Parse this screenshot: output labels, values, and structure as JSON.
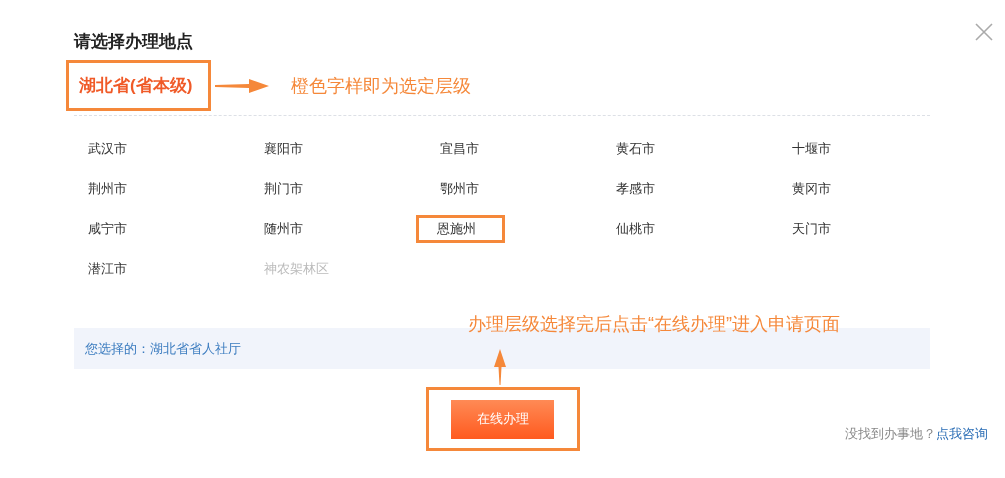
{
  "dialog": {
    "title": "请选择办理地点",
    "province": {
      "label": "湖北省(省本级)",
      "highlighted": true
    },
    "cities": [
      {
        "name": "武汉市",
        "disabled": false,
        "highlighted": false
      },
      {
        "name": "襄阳市",
        "disabled": false,
        "highlighted": false
      },
      {
        "name": "宜昌市",
        "disabled": false,
        "highlighted": false
      },
      {
        "name": "黄石市",
        "disabled": false,
        "highlighted": false
      },
      {
        "name": "十堰市",
        "disabled": false,
        "highlighted": false
      },
      {
        "name": "荆州市",
        "disabled": false,
        "highlighted": false
      },
      {
        "name": "荆门市",
        "disabled": false,
        "highlighted": false
      },
      {
        "name": "鄂州市",
        "disabled": false,
        "highlighted": false
      },
      {
        "name": "孝感市",
        "disabled": false,
        "highlighted": false
      },
      {
        "name": "黄冈市",
        "disabled": false,
        "highlighted": false
      },
      {
        "name": "咸宁市",
        "disabled": false,
        "highlighted": false
      },
      {
        "name": "随州市",
        "disabled": false,
        "highlighted": false
      },
      {
        "name": "恩施州",
        "disabled": false,
        "highlighted": true
      },
      {
        "name": "仙桃市",
        "disabled": false,
        "highlighted": false
      },
      {
        "name": "天门市",
        "disabled": false,
        "highlighted": false
      },
      {
        "name": "潜江市",
        "disabled": false,
        "highlighted": false
      },
      {
        "name": "神农架林区",
        "disabled": true,
        "highlighted": false
      }
    ],
    "selection": "您选择的：湖北省省人社厅",
    "button": {
      "label": "在线办理",
      "highlighted": true
    },
    "hint": "没找到办事地？",
    "hint_link": "点我咨询"
  },
  "annotations": [
    "橙色字样即为选定层级",
    "办理层级选择完后点击“在线办理”进入申请页面"
  ]
}
